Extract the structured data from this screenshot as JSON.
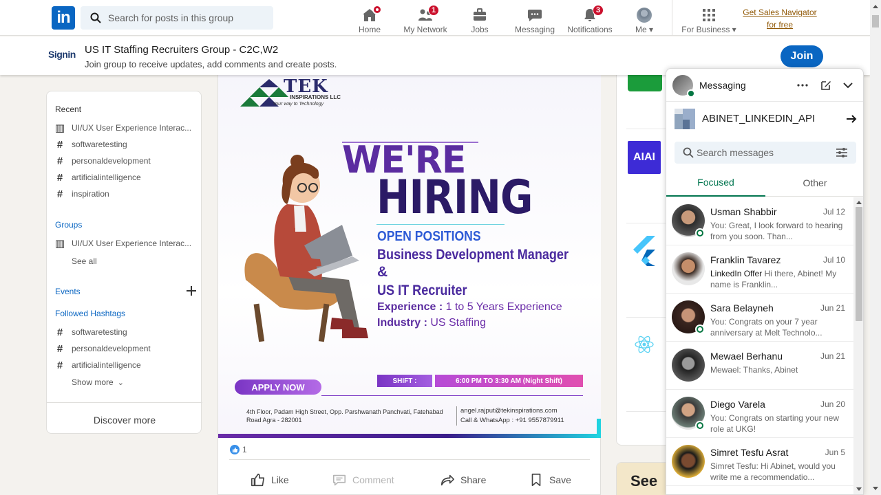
{
  "nav": {
    "logo_text": "in",
    "search_placeholder": "Search for posts in this group",
    "items": [
      {
        "label": "Home",
        "icon": "home-icon",
        "badge": ""
      },
      {
        "label": "My Network",
        "icon": "people-icon",
        "badge": "1"
      },
      {
        "label": "Jobs",
        "icon": "briefcase-icon",
        "badge": ""
      },
      {
        "label": "Messaging",
        "icon": "chat-icon",
        "badge": ""
      },
      {
        "label": "Notifications",
        "icon": "bell-icon",
        "badge": "3"
      },
      {
        "label": "Me",
        "icon": "avatar",
        "badge": ""
      },
      {
        "label": "For Business",
        "icon": "grid-icon",
        "badge": ""
      }
    ],
    "sales_navigator": [
      "Get Sales Navigator",
      "for free"
    ]
  },
  "group": {
    "logo_text": "Signin",
    "title": "US IT Staffing Recruiters Group - C2C,W2",
    "subtitle": "Join group to receive updates, add comments and create posts.",
    "join_label": "Join"
  },
  "sidebar": {
    "recent_heading": "Recent",
    "recent": [
      {
        "label": "UI/UX User Experience Interac...",
        "icon": "group-icon"
      },
      {
        "label": "softwaretesting",
        "icon": "hashtag-icon"
      },
      {
        "label": "personaldevelopment",
        "icon": "hashtag-icon"
      },
      {
        "label": "artificialintelligence",
        "icon": "hashtag-icon"
      },
      {
        "label": "inspiration",
        "icon": "hashtag-icon"
      }
    ],
    "groups_heading": "Groups",
    "groups": [
      {
        "label": "UI/UX User Experience Interac...",
        "icon": "group-icon"
      }
    ],
    "see_all": "See all",
    "events_heading": "Events",
    "followed_heading": "Followed Hashtags",
    "followed": [
      {
        "label": "softwaretesting",
        "icon": "hashtag-icon"
      },
      {
        "label": "personaldevelopment",
        "icon": "hashtag-icon"
      },
      {
        "label": "artificialintelligence",
        "icon": "hashtag-icon"
      }
    ],
    "show_more": "Show more",
    "discover_more": "Discover more"
  },
  "post": {
    "poster": {
      "company": "TEK",
      "company_sub": "INSPIRATIONS LLC",
      "tagline": "Your way to Technology",
      "headline1": "WE'RE",
      "headline2": "HIRING",
      "open_positions": "OPEN POSITIONS",
      "role1": "Business Development Manager",
      "amp": "&",
      "role2": "US IT Recruiter",
      "experience_label": "Experience :",
      "experience_value": " 1 to 5 Years Experience",
      "industry_label": "Industry :",
      "industry_value": " US Staffing",
      "apply": "APPLY NOW",
      "shift_label": "SHIFT :",
      "shift_time": "6:00 PM TO 3:30 AM (Night Shift)",
      "address": "4th Floor, Padam High  Street, Opp. Parshwanath Panchvati, Fatehabad  Road Agra - 282001",
      "email": "angel.rajput@tekinspirations.com",
      "phone": "Call & WhatsApp : +91 9557879911"
    },
    "reaction_count": "1",
    "actions": {
      "like": "Like",
      "comment": "Comment",
      "share": "Share",
      "save": "Save"
    }
  },
  "messaging": {
    "title": "Messaging",
    "account": "ABINET_LINKEDIN_API",
    "search_placeholder": "Search messages",
    "tabs": [
      "Focused",
      "Other"
    ],
    "conversations": [
      {
        "name": "Usman Shabbir",
        "date": "Jul 12",
        "prefix": "",
        "preview": "You: Great, I look forward to hearing from you soon. Than...",
        "online": true
      },
      {
        "name": "Franklin Tavarez",
        "date": "Jul 10",
        "prefix": "LinkedIn Offer",
        "preview": "  Hi there, Abinet! My name is Franklin...",
        "online": false
      },
      {
        "name": "Sara Belayneh",
        "date": "Jun 21",
        "prefix": "",
        "preview": "You: Congrats on your 7 year anniversary at Melt Technolo...",
        "online": true
      },
      {
        "name": "Mewael Berhanu",
        "date": "Jun 21",
        "prefix": "",
        "preview": "Mewael: Thanks, Abinet",
        "online": false
      },
      {
        "name": "Diego Varela",
        "date": "Jun 20",
        "prefix": "",
        "preview": "You: Congrats on starting your new role at UKG!",
        "online": true
      },
      {
        "name": "Simret Tesfu Asrat",
        "date": "Jun 5",
        "prefix": "",
        "preview": "Simret Tesfu: Hi Abinet, would you write me a recommendatio...",
        "online": false
      }
    ]
  },
  "right_rail": {
    "partial_text": "See w"
  },
  "colors": {
    "brand": "#0a66c2",
    "accent_green": "#01754f",
    "badge": "#cb112d"
  }
}
